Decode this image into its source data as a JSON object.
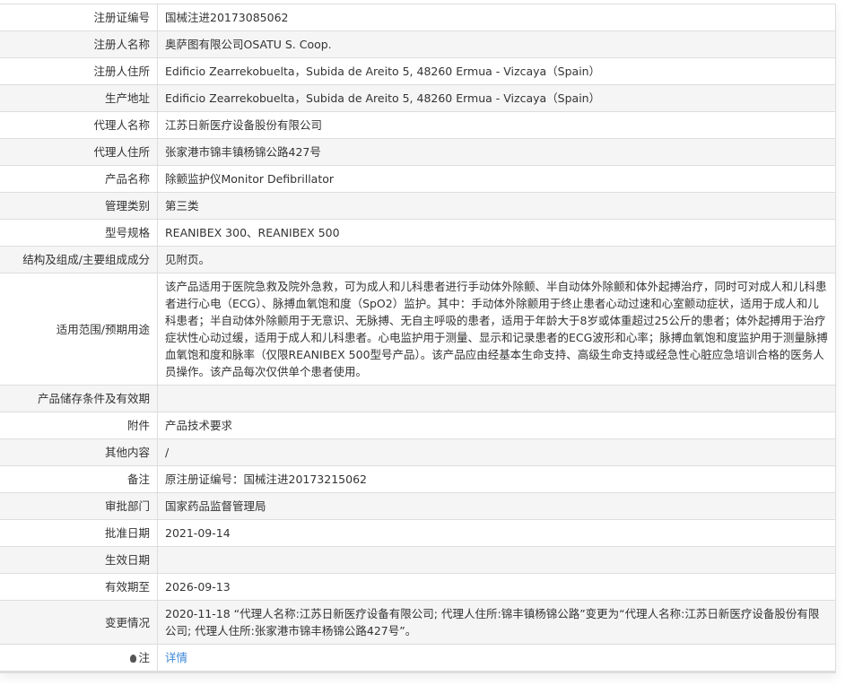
{
  "rows": [
    {
      "label": "注册证编号",
      "value": "国械注进20173085062"
    },
    {
      "label": "注册人名称",
      "value": "奥萨图有限公司OSATU S. Coop."
    },
    {
      "label": "注册人住所",
      "value": "Edificio Zearrekobuelta，Subida de Areito 5, 48260 Ermua - Vizcaya（Spain）"
    },
    {
      "label": "生产地址",
      "value": "Edificio Zearrekobuelta，Subida de Areito 5, 48260 Ermua - Vizcaya（Spain）"
    },
    {
      "label": "代理人名称",
      "value": "江苏日新医疗设备股份有限公司"
    },
    {
      "label": "代理人住所",
      "value": "张家港市锦丰镇杨锦公路427号"
    },
    {
      "label": "产品名称",
      "value": "除颤监护仪Monitor Defibrillator"
    },
    {
      "label": "管理类别",
      "value": "第三类"
    },
    {
      "label": "型号规格",
      "value": "REANIBEX 300、REANIBEX 500"
    },
    {
      "label": "结构及组成/主要组成成分",
      "value": "见附页。"
    },
    {
      "label": "适用范围/预期用途",
      "value": "该产品适用于医院急救及院外急救，可为成人和儿科患者进行手动体外除颤、半自动体外除颤和体外起搏治疗，同时可对成人和儿科患者进行心电（ECG）、脉搏血氧饱和度（SpO2）监护。其中：手动体外除颤用于终止患者心动过速和心室颤动症状，适用于成人和儿科患者；半自动体外除颤用于无意识、无脉搏、无自主呼吸的患者，适用于年龄大于8岁或体重超过25公斤的患者；体外起搏用于治疗症状性心动过缓，适用于成人和儿科患者。心电监护用于测量、显示和记录患者的ECG波形和心率；脉搏血氧饱和度监护用于测量脉搏血氧饱和度和脉率（仅限REANIBEX 500型号产品）。该产品应由经基本生命支持、高级生命支持或经急性心脏应急培训合格的医务人员操作。该产品每次仅供单个患者使用。"
    },
    {
      "label": "产品储存条件及有效期",
      "value": ""
    },
    {
      "label": "附件",
      "value": "产品技术要求"
    },
    {
      "label": "其他内容",
      "value": "/"
    },
    {
      "label": "备注",
      "value": "原注册证编号：国械注进20173215062"
    },
    {
      "label": "审批部门",
      "value": "国家药品监督管理局"
    },
    {
      "label": "批准日期",
      "value": "2021-09-14"
    },
    {
      "label": "生效日期",
      "value": ""
    },
    {
      "label": "有效期至",
      "value": "2026-09-13"
    },
    {
      "label": "变更情况",
      "value": "2020-11-18 “代理人名称:江苏日新医疗设备有限公司; 代理人住所:锦丰镇杨锦公路”变更为“代理人名称:江苏日新医疗设备股份有限公司; 代理人住所:张家港市锦丰杨锦公路427号”。"
    }
  ],
  "note": {
    "label": "注",
    "link": "详情",
    "icon": "lightbulb-icon"
  }
}
